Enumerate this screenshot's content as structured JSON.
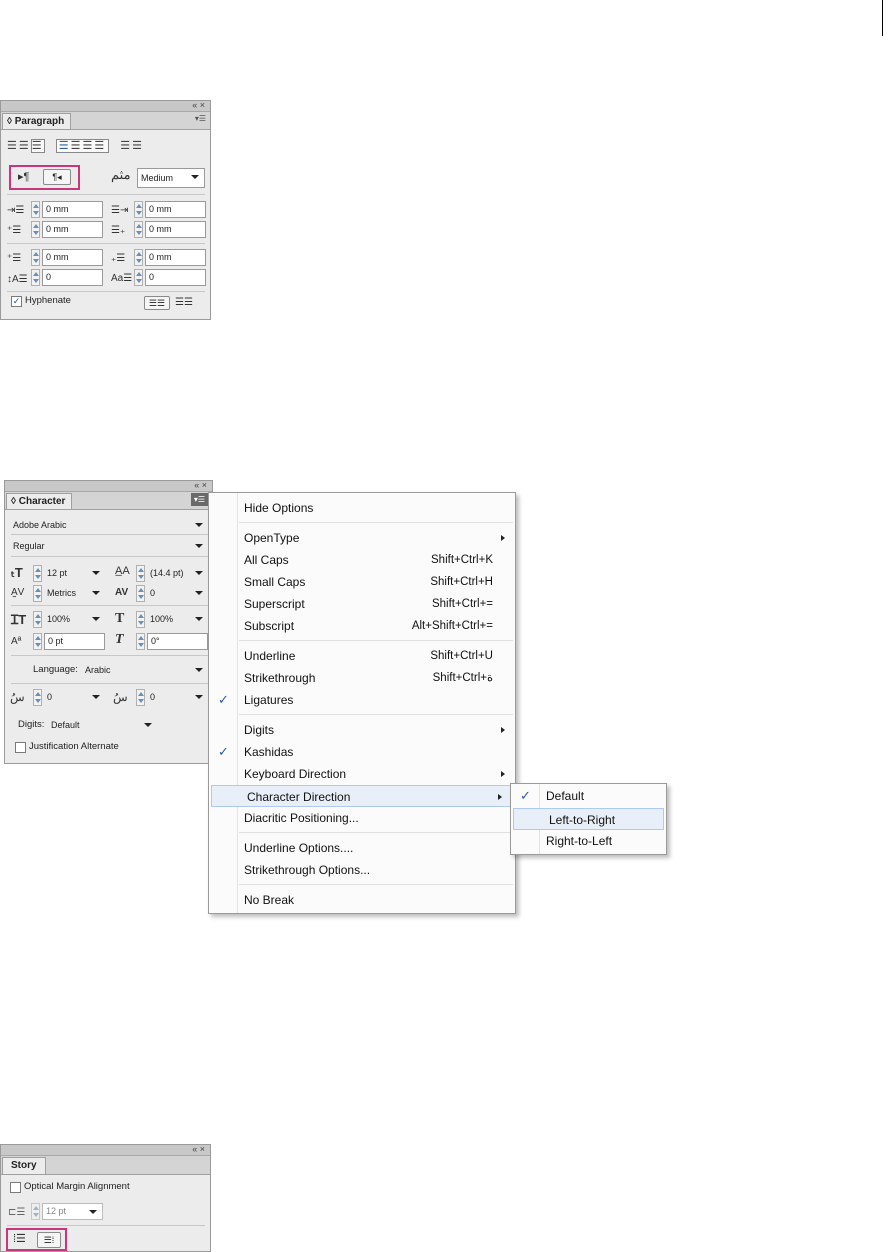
{
  "paragraph_panel": {
    "tab": "Paragraph",
    "top_controls": "« ×",
    "kashida_value": "Medium",
    "left_indent": "0 mm",
    "right_indent": "0 mm",
    "first_line_indent": "0 mm",
    "last_line_indent": "0 mm",
    "space_before": "0 mm",
    "space_after": "0 mm",
    "drop_cap_lines": "0",
    "drop_cap_chars": "0",
    "hyphenate_label": "Hyphenate",
    "hyphenate_checked": true
  },
  "character_panel": {
    "tab": "Character",
    "top_controls": "« ×",
    "font_family": "Adobe Arabic",
    "font_style": "Regular",
    "font_size": "12 pt",
    "leading": "(14.4 pt)",
    "kerning": "Metrics",
    "tracking": "0",
    "vertical_scale": "100%",
    "horizontal_scale": "100%",
    "baseline_shift": "0 pt",
    "skew": "0°",
    "language_label": "Language:",
    "language": "Arabic",
    "diacritic_x": "0",
    "diacritic_y": "0",
    "digits_label": "Digits:",
    "digits": "Default",
    "justification_label": "Justification Alternate"
  },
  "context_menu": {
    "items": [
      {
        "label": "Hide Options",
        "shortcut": "",
        "submenu": false,
        "checked": false
      },
      {
        "label": "OpenType",
        "shortcut": "",
        "submenu": true,
        "checked": false
      },
      {
        "label": "All Caps",
        "shortcut": "Shift+Ctrl+K",
        "submenu": false,
        "checked": false
      },
      {
        "label": "Small Caps",
        "shortcut": "Shift+Ctrl+H",
        "submenu": false,
        "checked": false
      },
      {
        "label": "Superscript",
        "shortcut": "Shift+Ctrl+=",
        "submenu": false,
        "checked": false
      },
      {
        "label": "Subscript",
        "shortcut": "Alt+Shift+Ctrl+=",
        "submenu": false,
        "checked": false
      },
      {
        "label": "Underline",
        "shortcut": "Shift+Ctrl+U",
        "submenu": false,
        "checked": false
      },
      {
        "label": "Strikethrough",
        "shortcut": "Shift+Ctrl+ة",
        "submenu": false,
        "checked": false
      },
      {
        "label": "Ligatures",
        "shortcut": "",
        "submenu": false,
        "checked": true
      },
      {
        "label": "Digits",
        "shortcut": "",
        "submenu": true,
        "checked": false
      },
      {
        "label": "Kashidas",
        "shortcut": "",
        "submenu": false,
        "checked": true
      },
      {
        "label": "Keyboard Direction",
        "shortcut": "",
        "submenu": true,
        "checked": false
      },
      {
        "label": "Character Direction",
        "shortcut": "",
        "submenu": true,
        "checked": false
      },
      {
        "label": "Diacritic Positioning...",
        "shortcut": "",
        "submenu": false,
        "checked": false
      },
      {
        "label": "Underline Options....",
        "shortcut": "",
        "submenu": false,
        "checked": false
      },
      {
        "label": "Strikethrough Options...",
        "shortcut": "",
        "submenu": false,
        "checked": false
      },
      {
        "label": "No Break",
        "shortcut": "",
        "submenu": false,
        "checked": false
      }
    ]
  },
  "submenu": {
    "items": [
      {
        "label": "Default",
        "checked": true
      },
      {
        "label": "Left-to-Right",
        "checked": false
      },
      {
        "label": "Right-to-Left",
        "checked": false
      }
    ]
  },
  "story_panel": {
    "tab": "Story",
    "top_controls": "« ×",
    "optical_margin_label": "Optical Margin Alignment",
    "optical_margin_size": "12 pt"
  }
}
